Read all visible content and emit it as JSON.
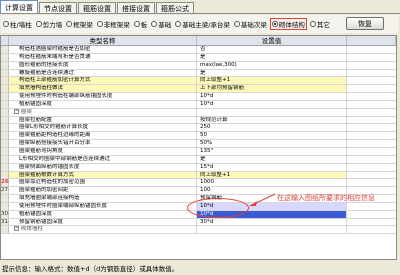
{
  "tabs": [
    "计算设置",
    "节点设置",
    "箍筋设置",
    "搭接设置",
    "箍筋公式"
  ],
  "filters": {
    "options": [
      "柱/墙柱",
      "剪力墙",
      "框架梁",
      "非框架梁",
      "板",
      "基础",
      "基础主梁/承台梁",
      "基础次梁",
      "砌体结构",
      "其它"
    ],
    "selected_index": 8
  },
  "restore_button": "恢复",
  "grid": {
    "headers": [
      "类型名称",
      "设置值"
    ],
    "rows": [
      {
        "n": "",
        "name": "构造柱遇圈梁时箍筋是否加密",
        "value": "否"
      },
      {
        "n": "",
        "name": "构造柱箍筋末端弯折是否贯通",
        "value": "是"
      },
      {
        "n": "",
        "name": "圆形箍筋的搭接长度",
        "value": "max(lae,300)"
      },
      {
        "n": "",
        "name": "螺旋箍筋是否连续通过",
        "value": "是"
      },
      {
        "n": "",
        "name": "构造柱上部箍筋加密计算方式",
        "value": "向上取整+1"
      },
      {
        "n": "",
        "name": "填充墙构造柱做法",
        "value": "上下部均预留钢筋"
      },
      {
        "n": "",
        "name": "使用预埋件时构造柱端部纵筋锚固长度",
        "value": "10*d"
      },
      {
        "n": "",
        "name": "植筋锚固深度",
        "value": "10*d"
      },
      {
        "n": "",
        "name": "圈梁",
        "value": "",
        "group": true
      },
      {
        "n": "",
        "name": "圈梁拉筋配置",
        "value": "按规范计算"
      },
      {
        "n": "",
        "name": "圈梁L形相交时箍筋计算长度",
        "value": "250"
      },
      {
        "n": "",
        "name": "圈梁箍筋距构造柱边缘的距离",
        "value": "50"
      },
      {
        "n": "",
        "name": "圈梁纵筋搭接接头错开百分率",
        "value": "50%"
      },
      {
        "n": "",
        "name": "圈梁箍筋弯钩角度",
        "value": "135°"
      },
      {
        "n": "",
        "name": "L形相交时圈梁中部钢筋是否连续通过",
        "value": "是"
      },
      {
        "n": "",
        "name": "圈梁侧面纵筋的锚固长度",
        "value": "15*d"
      },
      {
        "n": "",
        "name": "圈梁箍筋根数计算方式",
        "value": "向上取整+1"
      },
      {
        "n": "26",
        "name": "圈梁靠近构造柱的加密范围",
        "value": "1000"
      },
      {
        "n": "27",
        "name": "圈梁箍筋的加密间距",
        "value": "100"
      },
      {
        "n": "",
        "name": "填充墙圈梁端部连接构造",
        "value": "预留钢筋"
      },
      {
        "n": "",
        "name": "使用预埋件时圈梁端部纵筋锚固长度",
        "value": "10*d"
      },
      {
        "n": "30",
        "name": "植筋锚固深度",
        "value": "10*d"
      },
      {
        "n": "31",
        "name": "预留钢筋锚固深度",
        "value": "30*d"
      },
      {
        "n": "",
        "name": "砌体墙柱",
        "value": "",
        "group": true
      }
    ]
  },
  "annotation": "在这输入图纸所要求的相应信息",
  "status_bar": "提示信息：输入格式：数值+d（d为钢筋直径）或具体数值。"
}
